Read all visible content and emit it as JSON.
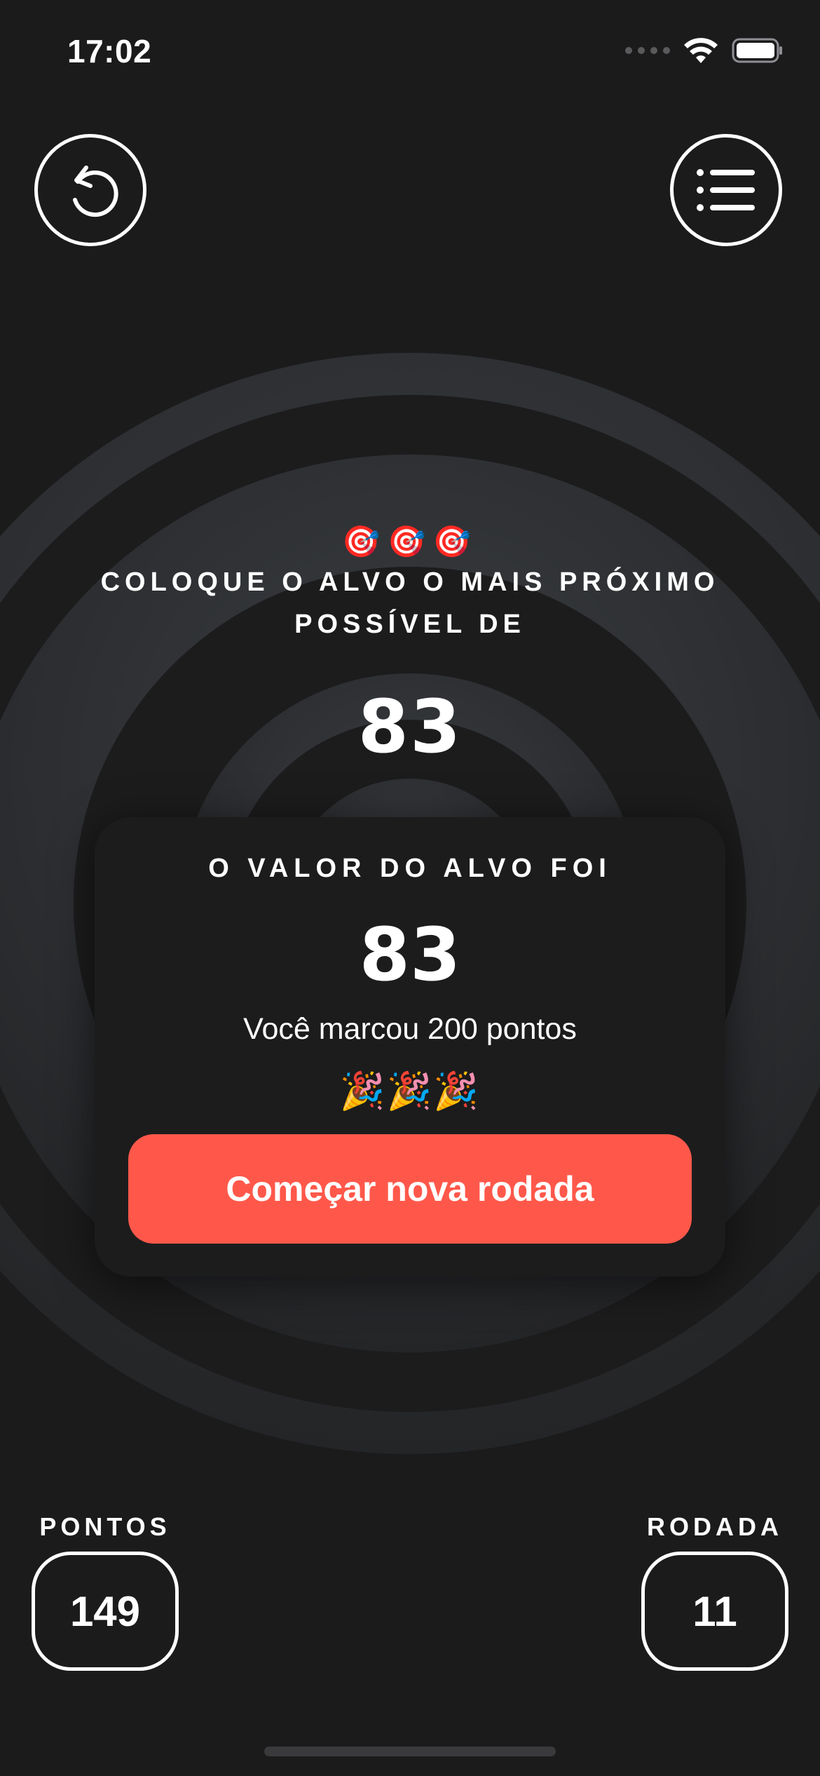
{
  "status_bar": {
    "time": "17:02"
  },
  "toolbar": {
    "restart_icon": "restart-arrow-icon",
    "leaderboard_icon": "list-icon"
  },
  "instructions": {
    "emojis": "🎯🎯🎯",
    "text": "COLOQUE O ALVO O MAIS PRÓXIMO POSSÍVEL DE",
    "target": "83"
  },
  "result": {
    "title": "O VALOR DO ALVO FOI",
    "value": "83",
    "score_text": "Você marcou 200 pontos",
    "emojis": "🎉🎉🎉",
    "button_label": "Começar nova rodada"
  },
  "stats": {
    "score_label": "PONTOS",
    "score_value": "149",
    "round_label": "RODADA",
    "round_value": "11"
  },
  "colors": {
    "background": "#1b1b1c",
    "accent": "#ff584a",
    "ring_dark": "#1e1f20",
    "ring_light": "#33363a"
  }
}
